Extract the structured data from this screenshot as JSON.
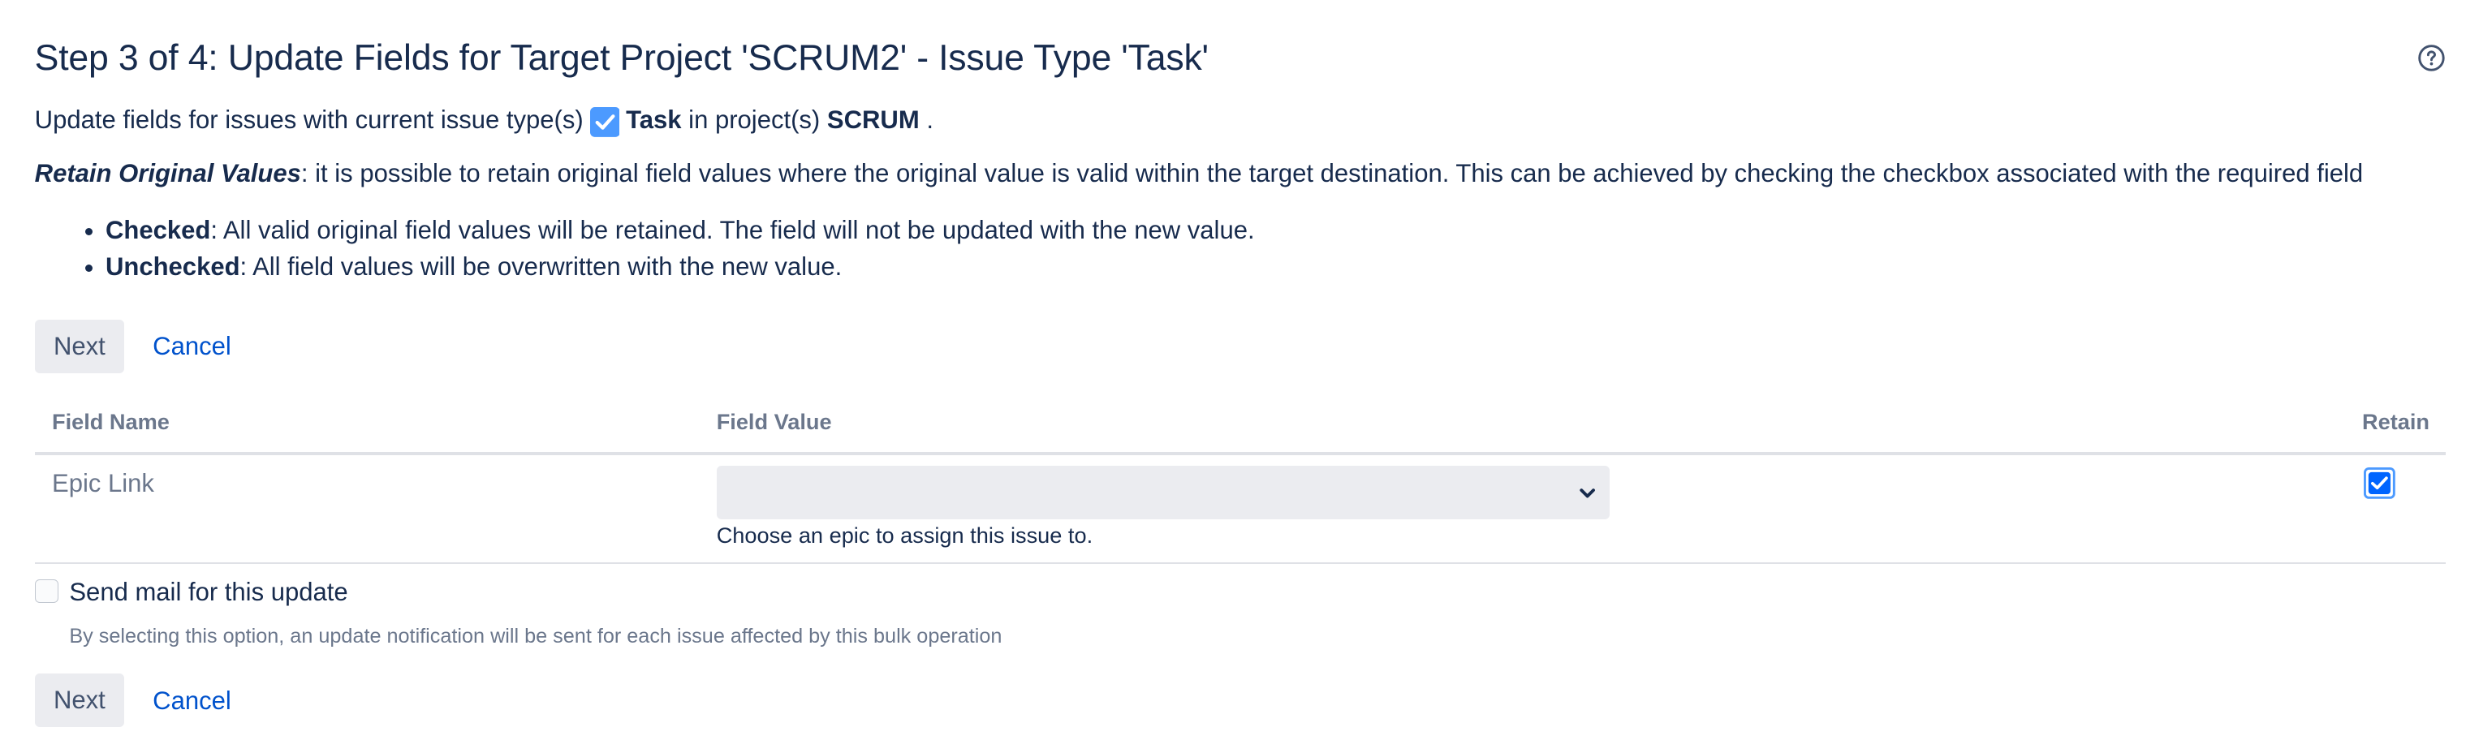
{
  "header": {
    "title": "Step 3 of 4: Update Fields for Target Project 'SCRUM2' - Issue Type 'Task'",
    "help_icon": "question-circle-icon"
  },
  "description": {
    "prefix": "Update fields for issues with current issue type(s)",
    "issue_type": "Task",
    "issue_type_icon": "task-checkbox-icon",
    "middle": "in project(s)",
    "project": "SCRUM",
    "suffix": "."
  },
  "retain_info": {
    "label": "Retain Original Values",
    "text": ": it is possible to retain original field values where the original value is valid within the target destination. This can be achieved by checking the checkbox associated with the required field"
  },
  "bullets": [
    {
      "term": "Checked",
      "text": ": All valid original field values will be retained. The field will not be updated with the new value."
    },
    {
      "term": "Unchecked",
      "text": ": All field values will be overwritten with the new value."
    }
  ],
  "top_actions": {
    "next_label": "Next",
    "cancel_label": "Cancel"
  },
  "table": {
    "headers": {
      "field_name": "Field Name",
      "field_value": "Field Value",
      "retain": "Retain"
    },
    "rows": [
      {
        "field_name": "Epic Link",
        "value": "",
        "description": "Choose an epic to assign this issue to.",
        "retain": true
      }
    ]
  },
  "mail": {
    "label": "Send mail for this update",
    "checked": false,
    "description": "By selecting this option, an update notification will be sent for each issue affected by this bulk operation"
  },
  "bottom_actions": {
    "next_label": "Next",
    "cancel_label": "Cancel"
  },
  "colors": {
    "accent": "#4c9aff",
    "link": "#0052cc",
    "text": "#172b4d",
    "muted": "#6b778c",
    "button_bg": "#ebecf0"
  }
}
